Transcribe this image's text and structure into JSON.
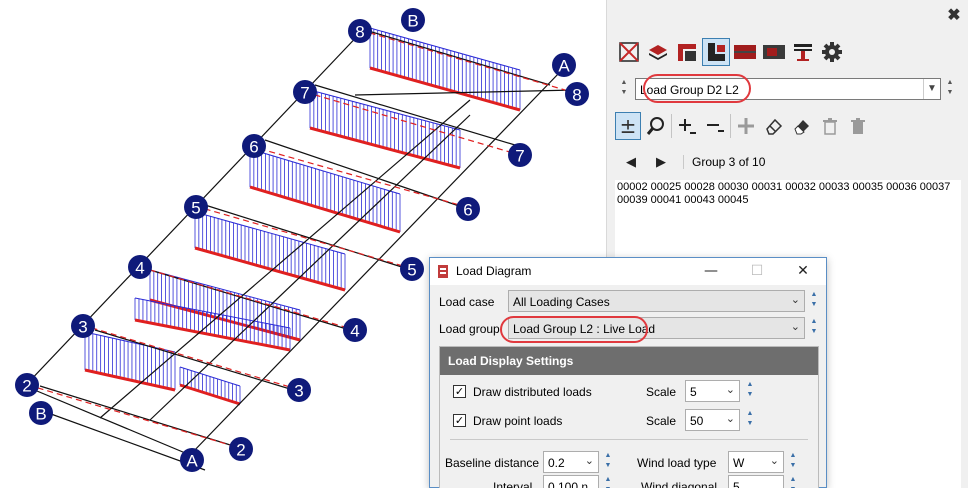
{
  "viewport": {
    "node_labels": {
      "n8a": "8",
      "nB": "B",
      "nA_top": "A",
      "n8b": "8",
      "n7a": "7",
      "n7b": "7",
      "n6a": "6",
      "n6b": "6",
      "n5a": "5",
      "n5b": "5",
      "n4a": "4",
      "n4b": "4",
      "n3a": "3",
      "n3b": "3",
      "n2a": "2",
      "nB_low": "B",
      "nA_low": "A",
      "n2b": "2"
    },
    "load_color": "#2b2bd6",
    "member_color": "#e02020",
    "node_color": "#0f1a7a"
  },
  "panel": {
    "toolbar_icons": [
      "select-box-icon",
      "layers-icon",
      "frame-icon",
      "corner-icon",
      "red-block-icon",
      "dark-block-icon",
      "ibeam-icon",
      "gear-icon"
    ],
    "group_select": {
      "value": "Load Group D2 L2"
    },
    "edit_icons": [
      "plus-minus-icon",
      "search-icon",
      "add-icon",
      "remove-icon",
      "plus-icon",
      "eraser-icon",
      "eraser-filled-icon",
      "trash-icon",
      "trash-filled-icon"
    ],
    "nav": {
      "prev": "◀",
      "next": "▶",
      "count": "Group 3 of 10"
    },
    "members": "00002 00025 00028 00030 00031 00032 00033 00035 00036 00037 00039 00041 00043 00045"
  },
  "dialog": {
    "title": "Load Diagram",
    "min": "—",
    "max": "☐",
    "close": "✕",
    "load_case_label": "Load case",
    "load_case_value": "All Loading Cases",
    "load_group_label": "Load group",
    "load_group_value": "Load Group L2 : Live Load",
    "settings_title": "Load Display Settings",
    "draw_distributed": "Draw distributed loads",
    "draw_point": "Draw point loads",
    "scale_label": "Scale",
    "scale_distributed": "5",
    "scale_point": "50",
    "baseline_label": "Baseline distance",
    "baseline_value": "0.2",
    "wind_type_label": "Wind load type",
    "wind_type_value": "W",
    "interval_label": "Interval",
    "interval_value": "0.100 n",
    "wind_diag_label": "Wind diagonal",
    "wind_diag_value": "5",
    "check_mark": "✓"
  }
}
